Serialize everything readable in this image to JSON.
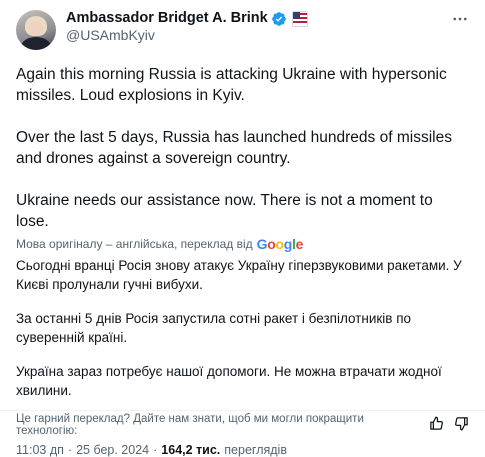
{
  "author": {
    "display_name": "Ambassador Bridget A. Brink",
    "handle": "@USAmbKyiv"
  },
  "tweet": {
    "original_paragraphs": [
      "Again this morning Russia is attacking Ukraine with hypersonic missiles. Loud explosions in Kyiv.",
      "Over the last 5 days, Russia has launched hundreds of missiles and drones against a sovereign country.",
      "Ukraine needs our assistance now.  There is not a moment to lose."
    ],
    "translation_note": "Мова оригіналу – англійська, переклад від",
    "translation_provider": "Google",
    "translated_paragraphs": [
      "Сьогодні вранці Росія знову атакує Україну гіперзвуковими ракетами. У Києві пролунали гучні вибухи.",
      "За останні 5 днів Росія запустила сотні ракет і безпілотників по суверенній країні.",
      "Україна зараз потребує нашої допомоги. Не можна втрачати жодної хвилини."
    ],
    "feedback_prompt": "Це гарний переклад? Дайте нам знати, щоб ми могли покращити технологію:"
  },
  "meta": {
    "time": "11:03 дп",
    "separator": "·",
    "date": "25 бер. 2024",
    "views_count": "164,2 тис.",
    "views_label": "переглядів"
  },
  "icons": {
    "verified": "verified-badge-icon",
    "flag": "us-flag-icon",
    "more": "more-options-icon",
    "thumbs_up": "thumbs-up-icon",
    "thumbs_down": "thumbs-down-icon"
  },
  "colors": {
    "verified": "#1d9bf0",
    "secondary_text": "#536471"
  }
}
